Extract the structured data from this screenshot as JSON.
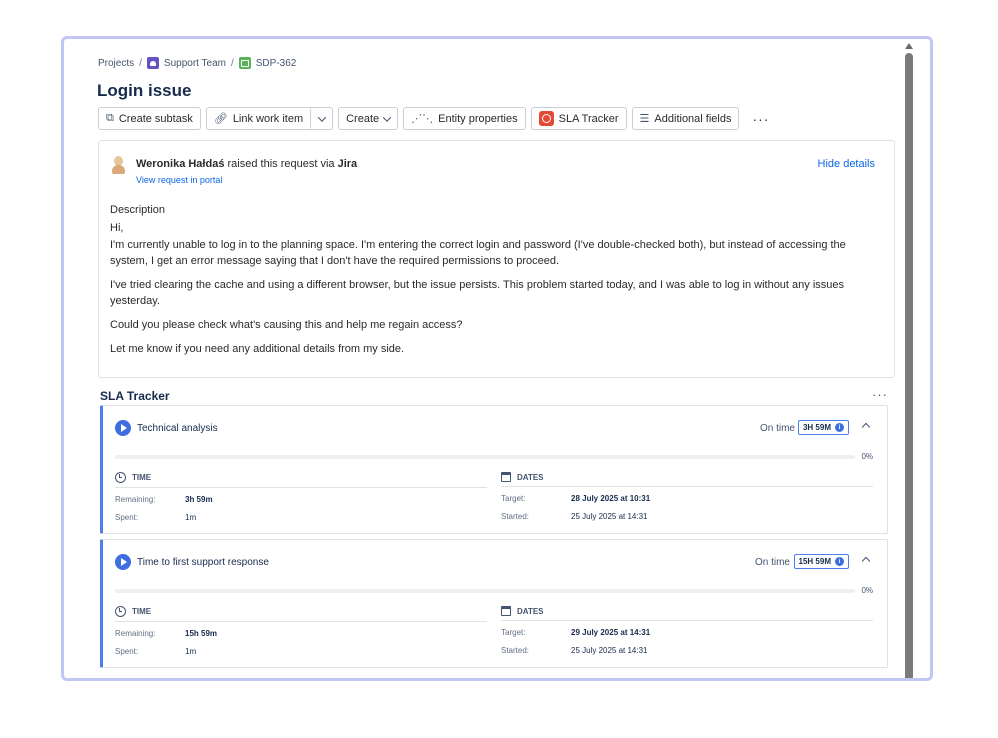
{
  "breadcrumb": {
    "projects": "Projects",
    "team": "Support Team",
    "issue_key": "SDP-362",
    "separator": "/"
  },
  "title": "Login issue",
  "toolbar": {
    "create_subtask": "Create subtask",
    "link_work_item": "Link work item",
    "create": "Create",
    "entity_properties": "Entity properties",
    "sla_tracker": "SLA Tracker",
    "additional_fields": "Additional fields",
    "more": "···"
  },
  "request": {
    "reporter": "Weronika Hałdaś",
    "raised_text": " raised this request via ",
    "channel": "Jira",
    "portal_link": "View request in portal",
    "hide_details": "Hide details",
    "description_heading": "Description",
    "description": [
      "Hi,",
      "I'm currently unable to log in to the planning space. I'm entering the correct login and password (I've double-checked both), but instead of accessing the system, I get an error message saying that I don't have the required permissions to proceed.",
      "I've tried clearing the cache and using a different browser, but the issue persists. This problem started today, and I was able to log in without any issues yesterday.",
      "Could you please check what's causing this and help me regain access?",
      "Let me know if you need any additional details from my side."
    ]
  },
  "sla": {
    "title": "SLA Tracker",
    "more": "···",
    "labels": {
      "time": "TIME",
      "dates": "DATES",
      "remaining": "Remaining:",
      "spent": "Spent:",
      "target": "Target:",
      "started": "Started:"
    },
    "cards": [
      {
        "name": "Technical analysis",
        "status": "On time",
        "badge": "3H 59M",
        "progress_percent": 0,
        "progress_label": "0%",
        "remaining": "3h 59m",
        "spent": "1m",
        "target": "28 July 2025 at 10:31",
        "started": "25 July 2025 at 14:31"
      },
      {
        "name": "Time to first support response",
        "status": "On time",
        "badge": "15H 59M",
        "progress_percent": 0,
        "progress_label": "0%",
        "remaining": "15h 59m",
        "spent": "1m",
        "target": "29 July 2025 at 14:31",
        "started": "25 July 2025 at 14:31"
      }
    ]
  },
  "colors": {
    "accent": "#4c7fe8",
    "link": "#0c66e4",
    "frame": "#c1c7f5",
    "sla_icon": "#e34935"
  }
}
